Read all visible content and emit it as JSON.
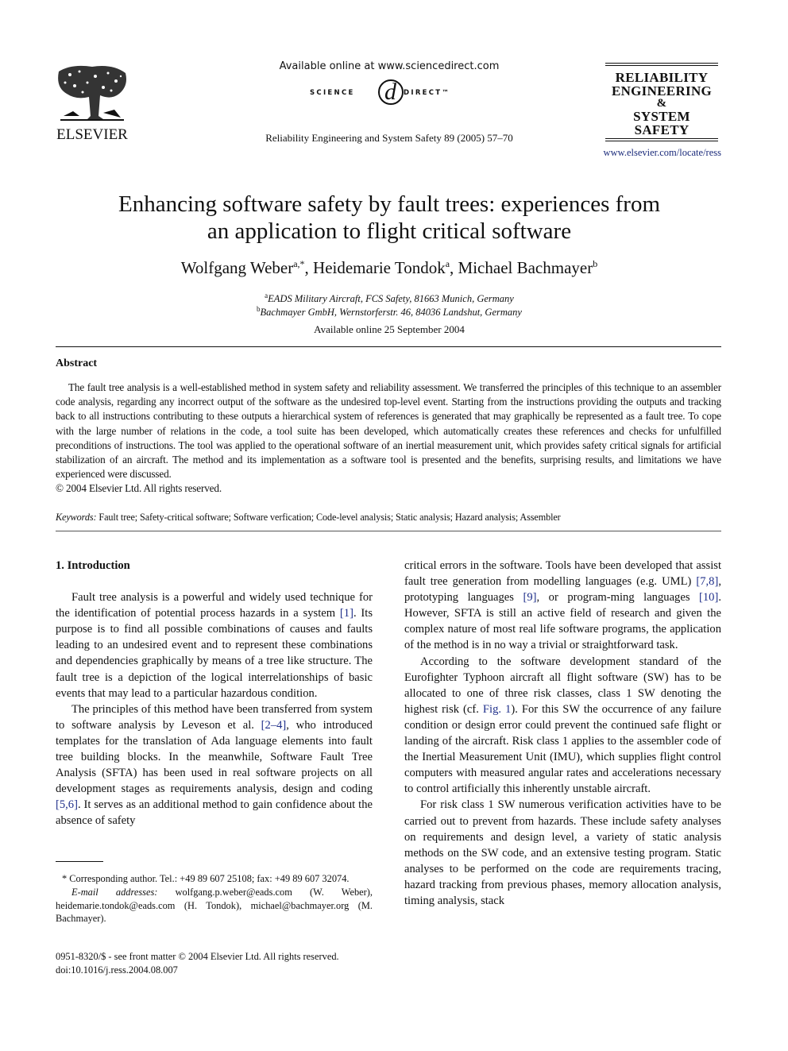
{
  "header": {
    "publisher": "ELSEVIER",
    "sciencedirect_available": "Available online at www.sciencedirect.com",
    "sciencedirect_logo_left": "SCIENCE",
    "sciencedirect_logo_at": "d",
    "sciencedirect_logo_right": "DIRECT™",
    "journal_reference": "Reliability Engineering and System Safety 89 (2005) 57–70",
    "journal_logo": {
      "line1": "RELIABILITY",
      "line2": "ENGINEERING",
      "line3": "&",
      "line4": "SYSTEM",
      "line5": "SAFETY"
    },
    "journal_url": "www.elsevier.com/locate/ress"
  },
  "article": {
    "title_line1": "Enhancing software safety by fault trees: experiences from",
    "title_line2": "an application to flight critical software",
    "authors": [
      {
        "name": "Wolfgang Weber",
        "sup": "a,*"
      },
      {
        "name": "Heidemarie Tondok",
        "sup": "a"
      },
      {
        "name": "Michael Bachmayer",
        "sup": "b"
      }
    ],
    "author_separator": ", ",
    "affiliations": [
      {
        "sup": "a",
        "text": "EADS Military Aircraft, FCS Safety, 81663 Munich, Germany"
      },
      {
        "sup": "b",
        "text": "Bachmayer GmbH, Wernstorferstr. 46, 84036 Landshut, Germany"
      }
    ],
    "available_online": "Available online 25 September 2004"
  },
  "abstract": {
    "heading": "Abstract",
    "body": "The fault tree analysis is a well-established method in system safety and reliability assessment. We transferred the principles of this technique to an assembler code analysis, regarding any incorrect output of the software as the undesired top-level event. Starting from the instructions providing the outputs and tracking back to all instructions contributing to these outputs a hierarchical system of references is generated that may graphically be represented as a fault tree. To cope with the large number of relations in the code, a tool suite has been developed, which automatically creates these references and checks for unfulfilled preconditions of instructions. The tool was applied to the operational software of an inertial measurement unit, which provides safety critical signals for artificial stabilization of an aircraft. The method and its implementation as a software tool is presented and the benefits, surprising results, and limitations we have experienced were discussed.",
    "copyright": "© 2004 Elsevier Ltd. All rights reserved."
  },
  "keywords": {
    "label": "Keywords:",
    "items": "Fault tree; Safety-critical software; Software verfication; Code-level analysis; Static analysis; Hazard analysis; Assembler"
  },
  "section1": {
    "heading": "1. Introduction",
    "p1": {
      "a": "Fault tree analysis is a powerful and widely used technique for the identification of potential process hazards in a system ",
      "cite1": "[1]",
      "b": ". Its purpose is to find all possible combinations of causes and faults leading to an undesired event and to represent these combinations and dependencies graphically by means of a tree like structure. The fault tree is a depiction of the logical interrelationships of basic events that may lead to a particular hazardous condition."
    },
    "p2": {
      "a": "The principles of this method have been transferred from system to software analysis by Leveson et al. ",
      "cite1": "[2–4]",
      "b": ", who introduced templates for the translation of Ada language elements into fault tree building blocks. In the meanwhile, Software Fault Tree Analysis (SFTA) has been used in real software projects on all development stages as requirements analysis, design and coding ",
      "cite2": "[5,6]",
      "c": ". It serves as an additional method to gain confidence about the absence of safety critical errors in the software. Tools have been developed that assist fault tree generation from modelling languages (e.g. UML) ",
      "cite3": "[7,8]",
      "d": ", prototyping languages ",
      "cite4": "[9]",
      "e": ", or programming languages ",
      "cite5": "[10]",
      "f": ". However, SFTA is still an active field of research and given the complex nature of most real life software programs, the application of the method is in no way a trivial or straightforward task."
    },
    "p3": {
      "a": "According to the software development standard of the Eurofighter Typhoon aircraft all flight software (SW) has to be allocated to one of three risk classes, class 1 SW denoting the highest risk (cf. ",
      "fig": "Fig. 1",
      "b": "). For this SW the occurrence of any failure condition or design error could prevent the continued safe flight or landing of the aircraft. Risk class 1 applies to the assembler code of the Inertial Measurement Unit (IMU), which supplies flight control computers with measured angular rates and accelerations necessary to control artificially this inherently unstable aircraft."
    },
    "p4": "For risk class 1 SW numerous verification activities have to be carried out to prevent from hazards. These include safety analyses on requirements and design level, a variety of static analysis methods on the SW code, and an extensive testing program. Static analyses to be performed on the code are requirements tracing, hazard tracking from previous phases, memory allocation analysis, timing analysis, stack"
  },
  "footnotes": {
    "corresponding": "* Corresponding author. Tel.: +49 89 607 25108; fax: +49 89 607 32074.",
    "email_label": "E-mail addresses:",
    "email_text": " wolfgang.p.weber@eads.com (W. Weber), heidemarie.tondok@eads.com (H. Tondok), michael@bachmayer.org (M. Bachmayer).",
    "front_matter": "0951-8320/$ - see front matter © 2004 Elsevier Ltd. All rights reserved.",
    "doi": "doi:10.1016/j.ress.2004.08.007"
  },
  "colors": {
    "text": "#111111",
    "link": "#1f2f8a",
    "rule": "#111111"
  }
}
